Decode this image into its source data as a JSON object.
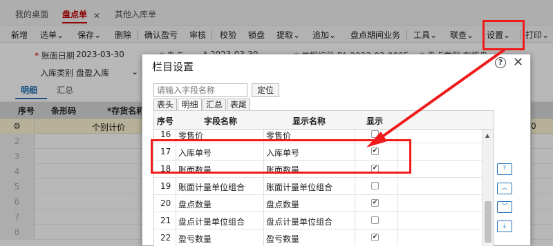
{
  "top_tabs": [
    {
      "label": "我的桌面"
    },
    {
      "label": "盘点单"
    },
    {
      "label": "其他入库单"
    }
  ],
  "toolbar": [
    {
      "label": "新增",
      "menu": false
    },
    {
      "label": "选单",
      "menu": true
    },
    {
      "label": "保存",
      "menu": true
    },
    {
      "label": "删除",
      "menu": false
    },
    {
      "label": "确认盈亏",
      "menu": false
    },
    {
      "label": "审核",
      "menu": false
    },
    {
      "label": "校验",
      "menu": false
    },
    {
      "label": "锁盘",
      "menu": false
    },
    {
      "label": "提取",
      "menu": true
    },
    {
      "label": "追加",
      "menu": true
    },
    {
      "label": "盘点期间业务",
      "menu": false
    },
    {
      "label": "工具",
      "menu": true
    },
    {
      "label": "联查",
      "menu": true
    },
    {
      "label": "设置",
      "menu": true
    },
    {
      "label": "打印",
      "menu": true
    }
  ],
  "form": {
    "account_date_label": "账面日期",
    "account_date_value": "2023-03-30",
    "stock_type_label": "入库类别",
    "stock_type_value": "盘盈入库",
    "partial_1": "* 盘点",
    "partial_2": "* 2023-03-30",
    "partial_3": "* 单据编号 PA-2023-03-0005",
    "partial_4": "* 盘点类型 存货盘"
  },
  "sub_tabs": [
    {
      "label": "明细"
    },
    {
      "label": "汇总"
    }
  ],
  "grid": {
    "headers": {
      "seq": "序号",
      "barcode": "条形码",
      "item": "*存货名称"
    },
    "rows": [
      {
        "seq": "",
        "cell": "个别计价",
        "right": "0"
      },
      {
        "seq": "2"
      },
      {
        "seq": "3"
      },
      {
        "seq": "4"
      },
      {
        "seq": "5"
      },
      {
        "seq": "6"
      },
      {
        "seq": "7"
      },
      {
        "seq": "8"
      }
    ]
  },
  "dialog": {
    "title": "栏目设置",
    "search_placeholder": "请输入字段名称",
    "locate_label": "定位",
    "tabs": [
      {
        "label": "表头"
      },
      {
        "label": "明细"
      },
      {
        "label": "汇总"
      },
      {
        "label": "表尾"
      }
    ],
    "columns": {
      "seq": "序号",
      "field": "字段名称",
      "display": "显示名称",
      "show": "显示"
    },
    "rows": [
      {
        "seq": "16",
        "field": "零售价",
        "display": "零售价",
        "checked": false
      },
      {
        "seq": "17",
        "field": "入库单号",
        "display": "入库单号",
        "checked": true
      },
      {
        "seq": "18",
        "field": "账面数量",
        "display": "账面数量",
        "checked": true
      },
      {
        "seq": "19",
        "field": "账面计量单位组合",
        "display": "账面计量单位组合",
        "checked": false
      },
      {
        "seq": "20",
        "field": "盘点数量",
        "display": "盘点数量",
        "checked": true
      },
      {
        "seq": "21",
        "field": "盘点计量单位组合",
        "display": "盘点计量单位组合",
        "checked": false
      },
      {
        "seq": "22",
        "field": "盈亏数量",
        "display": "盈亏数量",
        "checked": true
      }
    ],
    "move_buttons": [
      {
        "icon": "move-top-icon"
      },
      {
        "icon": "move-up-icon"
      },
      {
        "icon": "move-down-icon"
      },
      {
        "icon": "move-bottom-icon"
      }
    ]
  },
  "colors": {
    "accent": "#c40000",
    "link": "#1f6fb8",
    "highlight": "#ef1a1a"
  }
}
